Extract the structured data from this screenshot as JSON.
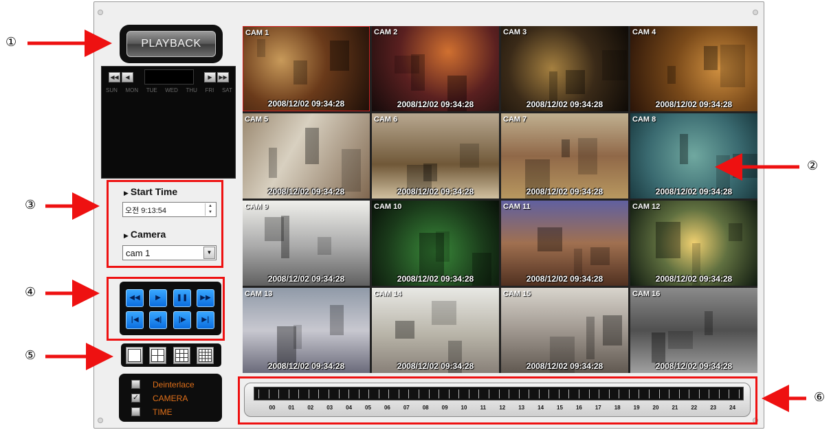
{
  "controls": {
    "playback_label": "PLAYBACK"
  },
  "calendar": {
    "month_label": "",
    "weekdays": [
      "SUN",
      "MON",
      "TUE",
      "WED",
      "THU",
      "FRI",
      "SAT"
    ],
    "nav_prev_year": "◀◀",
    "nav_prev_month": "◀",
    "nav_next_month": "▶",
    "nav_next_year": "▶▶"
  },
  "search": {
    "start_time_label": "Start Time",
    "start_time_value": "오전  9:13:54",
    "camera_label": "Camera",
    "camera_value": "cam 1"
  },
  "playback_buttons": [
    {
      "icon": "rewind-icon",
      "glyph": "◀◀"
    },
    {
      "icon": "play-icon",
      "glyph": "▶"
    },
    {
      "icon": "pause-icon",
      "glyph": "❚❚"
    },
    {
      "icon": "fast-forward-icon",
      "glyph": "▶▶"
    },
    {
      "icon": "skip-to-start-icon",
      "glyph": "|◀"
    },
    {
      "icon": "step-back-icon",
      "glyph": "◀|"
    },
    {
      "icon": "step-forward-icon",
      "glyph": "|▶"
    },
    {
      "icon": "skip-to-end-icon",
      "glyph": "▶|"
    }
  ],
  "layouts": [
    "layout-1x1-icon",
    "layout-2x2-icon",
    "layout-3x3-icon",
    "layout-4x4-icon"
  ],
  "options": [
    {
      "label": "Deinterlace",
      "checked": false
    },
    {
      "label": "CAMERA",
      "checked": true
    },
    {
      "label": "TIME",
      "checked": false
    }
  ],
  "cameras": [
    {
      "name": "CAM 1",
      "timestamp": "2008/12/02  09:34:28"
    },
    {
      "name": "CAM 2",
      "timestamp": "2008/12/02  09:34:28"
    },
    {
      "name": "CAM 3",
      "timestamp": "2008/12/02  09:34:28"
    },
    {
      "name": "CAM 4",
      "timestamp": "2008/12/02  09:34:28"
    },
    {
      "name": "CAM 5",
      "timestamp": "2008/12/02  09:34:28"
    },
    {
      "name": "CAM 6",
      "timestamp": "2008/12/02  09:34:28"
    },
    {
      "name": "CAM 7",
      "timestamp": "2008/12/02  09:34:28"
    },
    {
      "name": "CAM 8",
      "timestamp": "2008/12/02  09:34:28"
    },
    {
      "name": "CAM 9",
      "timestamp": "2008/12/02  09:34:28"
    },
    {
      "name": "CAM 10",
      "timestamp": "2008/12/02  09:34:28"
    },
    {
      "name": "CAM 11",
      "timestamp": "2008/12/02  09:34:28"
    },
    {
      "name": "CAM 12",
      "timestamp": "2008/12/02  09:34:28"
    },
    {
      "name": "CAM 13",
      "timestamp": "2008/12/02  09:34:28"
    },
    {
      "name": "CAM 14",
      "timestamp": "2008/12/02  09:34:28"
    },
    {
      "name": "CAM 15",
      "timestamp": "2008/12/02  09:34:28"
    },
    {
      "name": "CAM 16",
      "timestamp": "2008/12/02  09:34:28"
    }
  ],
  "timeline": {
    "hours": [
      "00",
      "01",
      "02",
      "03",
      "04",
      "05",
      "06",
      "07",
      "08",
      "09",
      "10",
      "11",
      "12",
      "13",
      "14",
      "15",
      "16",
      "17",
      "18",
      "19",
      "20",
      "21",
      "22",
      "23",
      "24"
    ]
  },
  "annotations": [
    "①",
    "②",
    "③",
    "④",
    "⑤",
    "⑥"
  ],
  "colors": {
    "highlight_red": "#ee1111",
    "control_blue": "#1a8cf0",
    "option_orange": "#e0701a"
  }
}
